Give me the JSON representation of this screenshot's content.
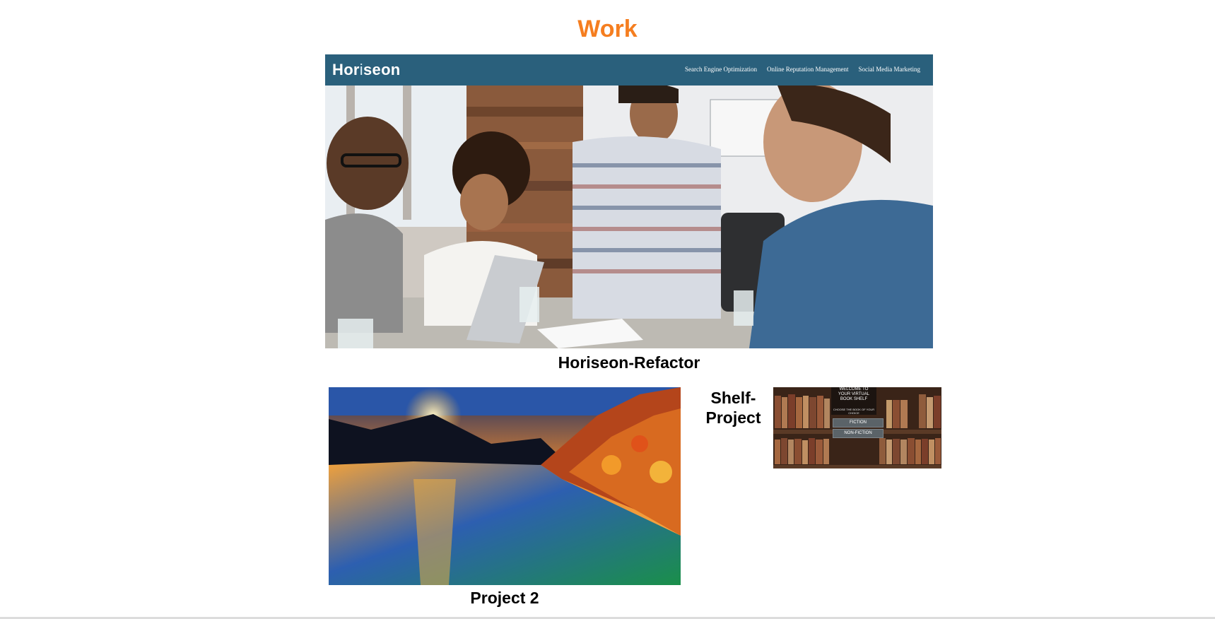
{
  "section": {
    "title": "Work"
  },
  "projects": [
    {
      "caption": "Horiseon-Refactor",
      "preview": {
        "logo_prefix": "Hor",
        "logo_accent": "i",
        "logo_suffix": "seon",
        "nav": [
          "Search Engine Optimization",
          "Online Reputation Management",
          "Social Media Marketing"
        ]
      }
    },
    {
      "caption": "Project 2"
    },
    {
      "caption_line1": "Shelf-",
      "caption_line2": "Project",
      "preview": {
        "sign": [
          "WELCOME TO",
          "YOUR VIRTUAL",
          "BOOK SHELF"
        ],
        "subtitle": "CHOOSE THE BOOK OF YOUR CHOICE",
        "buttons": [
          "FICTION",
          "NON-FICTION"
        ]
      }
    }
  ],
  "colors": {
    "title": "#f57e20",
    "horiseon_header": "#2a607c",
    "text": "#000000"
  }
}
